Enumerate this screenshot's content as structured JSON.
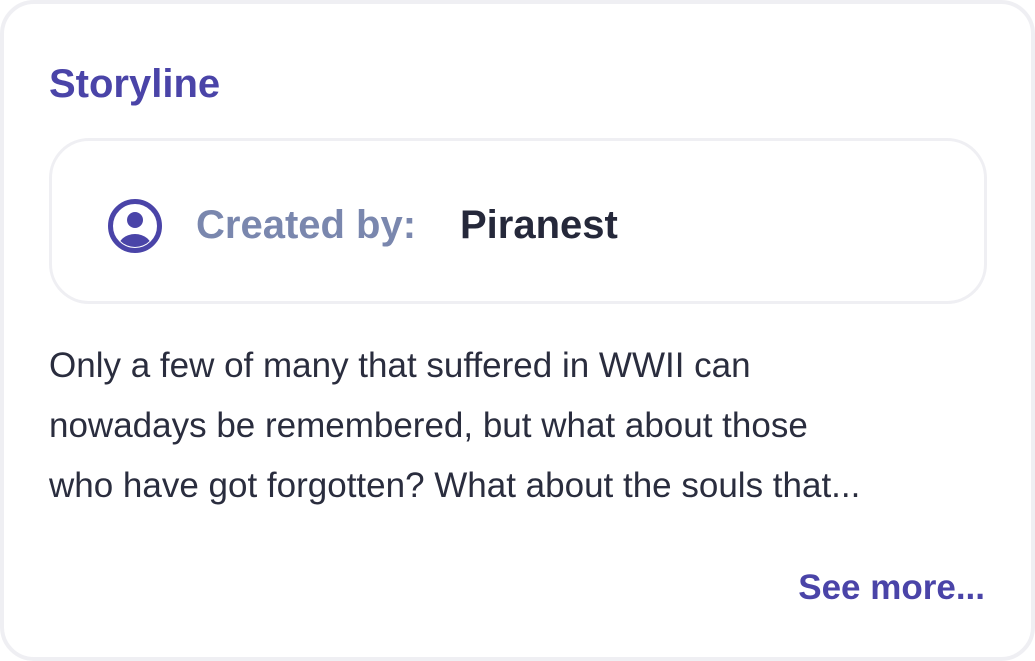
{
  "card": {
    "title": "Storyline",
    "creator": {
      "label": "Created by:",
      "name": "Piranest",
      "icon": "user-circle-icon"
    },
    "synopsis_lines": [
      "Only a few of many that suffered in WWII can",
      "nowadays be remembered, but what about those",
      "who have got forgotten? What about the souls that..."
    ],
    "see_more_label": "See more..."
  },
  "colors": {
    "accent": "#4a44a8",
    "label": "#7a87ae",
    "text": "#25283a",
    "border": "#efeff3"
  }
}
